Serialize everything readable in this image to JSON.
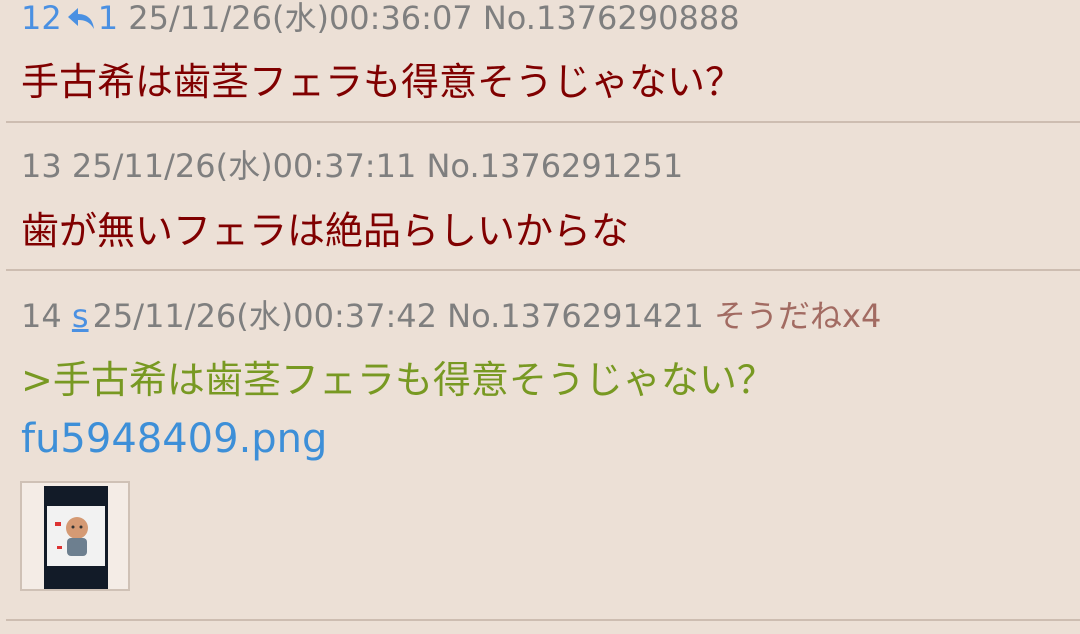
{
  "posts": [
    {
      "number": "12",
      "reply_count": "1",
      "datetime": "25/11/26(水)00:36:07",
      "post_no": "No.1376290888",
      "body": "手古希は歯茎フェラも得意そうじゃない？"
    },
    {
      "number": "13",
      "datetime": "25/11/26(水)00:37:11",
      "post_no": "No.1376291251",
      "body": "歯が無いフェラは絶品らしいからな"
    },
    {
      "number": "14",
      "s_link": "s",
      "datetime": "25/11/26(水)00:37:42",
      "post_no": "No.1376291421",
      "soudane": "そうだねx4",
      "quote": ">手古希は歯茎フェラも得意そうじゃない？",
      "file_name": "fu5948409.png"
    }
  ],
  "colors": {
    "background": "#ece0d6",
    "meta_text": "#7f7f7f",
    "body_text": "#800000",
    "quote_text": "#789922",
    "link": "#4a90e2",
    "soudane": "#a26b62",
    "divider": "#cdbdb1"
  },
  "icons": {
    "reply": "reply-arrow-icon"
  }
}
